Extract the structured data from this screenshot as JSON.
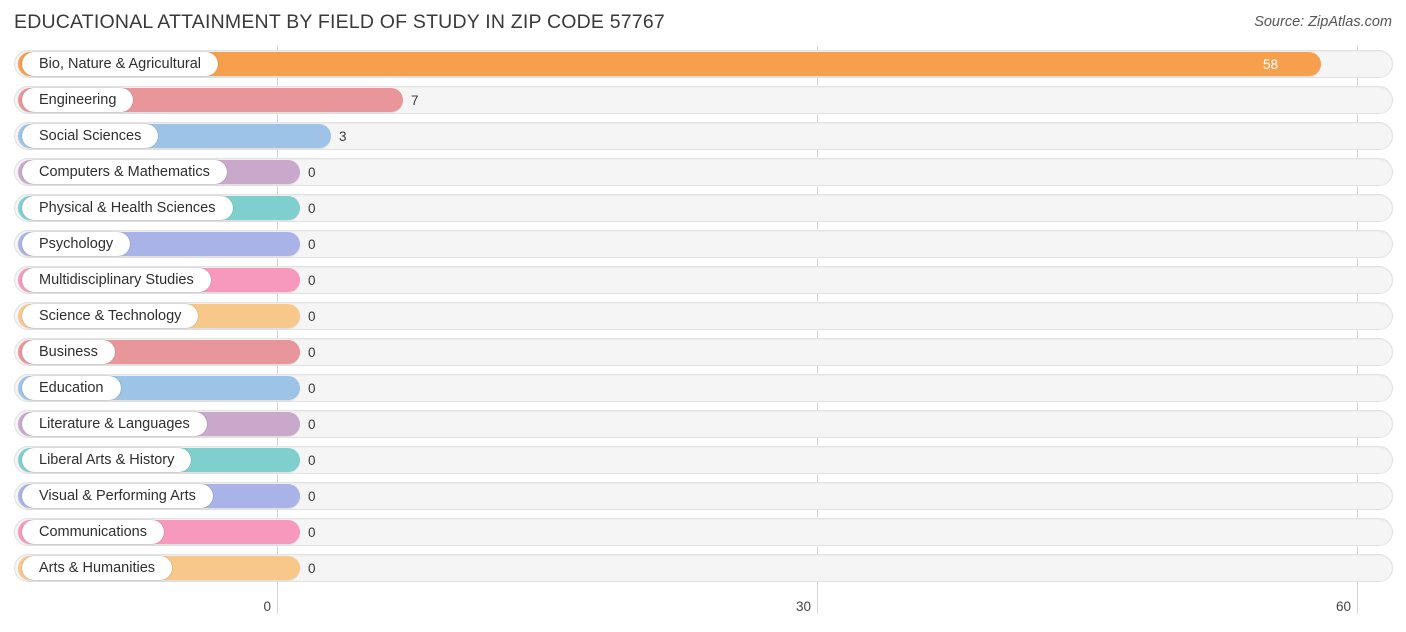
{
  "header": {
    "title": "EDUCATIONAL ATTAINMENT BY FIELD OF STUDY IN ZIP CODE 57767",
    "source": "Source: ZipAtlas.com"
  },
  "axis": {
    "ticks": [
      {
        "label": "0",
        "value": 0
      },
      {
        "label": "30",
        "value": 30
      },
      {
        "label": "60",
        "value": 60
      }
    ]
  },
  "chart_data": {
    "type": "bar",
    "orientation": "horizontal",
    "title": "EDUCATIONAL ATTAINMENT BY FIELD OF STUDY IN ZIP CODE 57767",
    "source": "Source: ZipAtlas.com",
    "xlabel": "",
    "ylabel": "",
    "xlim": [
      0,
      60
    ],
    "xticks": [
      0,
      30,
      60
    ],
    "grid": true,
    "legend": false,
    "categories": [
      "Bio, Nature & Agricultural",
      "Engineering",
      "Social Sciences",
      "Computers & Mathematics",
      "Physical & Health Sciences",
      "Psychology",
      "Multidisciplinary Studies",
      "Science & Technology",
      "Business",
      "Education",
      "Literature & Languages",
      "Liberal Arts & History",
      "Visual & Performing Arts",
      "Communications",
      "Arts & Humanities"
    ],
    "values": [
      58,
      7,
      3,
      0,
      0,
      0,
      0,
      0,
      0,
      0,
      0,
      0,
      0,
      0,
      0
    ],
    "value_labels": [
      "58",
      "7",
      "3",
      "0",
      "0",
      "0",
      "0",
      "0",
      "0",
      "0",
      "0",
      "0",
      "0",
      "0",
      "0"
    ],
    "colors": [
      "#f6a04d",
      "#e89699",
      "#9dc3e6",
      "#c9a8cc",
      "#7fcfcf",
      "#aab3e8",
      "#f799bd",
      "#f8c88b",
      "#e89699",
      "#9dc3e6",
      "#c9a8cc",
      "#7fcfcf",
      "#aab3e8",
      "#f799bd",
      "#f8c88b"
    ]
  }
}
